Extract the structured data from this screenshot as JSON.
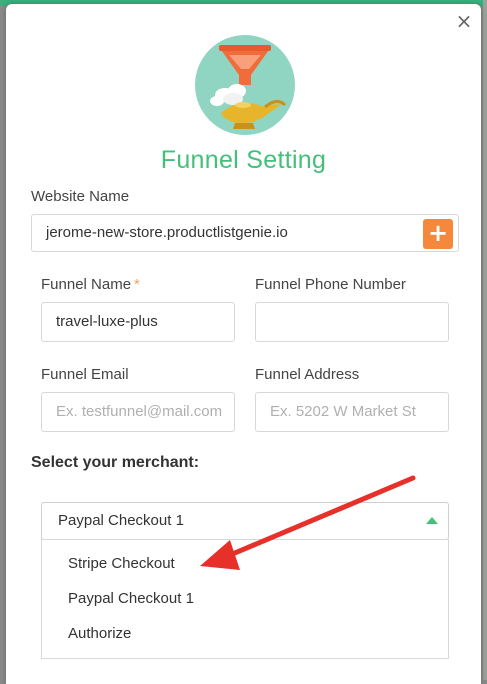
{
  "modal": {
    "title": "Funnel Setting",
    "close_icon": "×"
  },
  "website": {
    "label": "Website Name",
    "value": "jerome-new-store.productlistgenie.io",
    "add_icon": "+"
  },
  "funnel_name": {
    "label": "Funnel Name",
    "required_mark": "*",
    "value": "travel-luxe-plus"
  },
  "funnel_phone": {
    "label": "Funnel Phone Number",
    "value": ""
  },
  "funnel_email": {
    "label": "Funnel Email",
    "placeholder": "Ex. testfunnel@mail.com"
  },
  "funnel_address": {
    "label": "Funnel Address",
    "placeholder": "Ex. 5202 W Market St"
  },
  "merchant": {
    "label": "Select your merchant:",
    "selected": "Paypal Checkout 1",
    "options": [
      "Stripe Checkout",
      "Paypal Checkout 1",
      "Authorize"
    ]
  },
  "colors": {
    "accent_green": "#43c07a",
    "add_button_orange": "#f5883a",
    "annotation_arrow_red": "#e8302a",
    "logo_background": "#8fd5c2"
  }
}
